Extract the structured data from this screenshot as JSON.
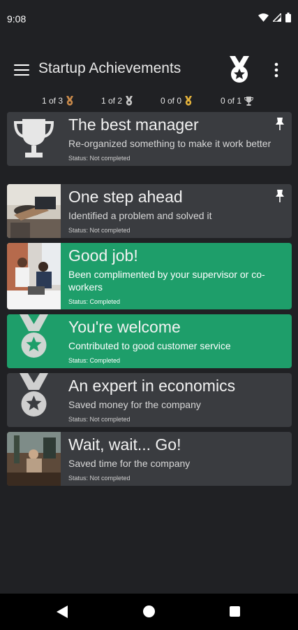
{
  "status_bar": {
    "time": "9:08"
  },
  "app_bar": {
    "title": "Startup Achievements"
  },
  "summary": [
    {
      "text": "1 of 3",
      "icon": "bronze-medal-icon",
      "color": "#c98a4a"
    },
    {
      "text": "1 of 2",
      "icon": "silver-medal-icon",
      "color": "#c8c8c8"
    },
    {
      "text": "0 of 0",
      "icon": "gold-medal-icon",
      "color": "#e3b23c"
    },
    {
      "text": "0 of 1",
      "icon": "trophy-icon",
      "color": "#c8c8c8"
    }
  ],
  "achievements": [
    {
      "title": "The best manager",
      "description": "Re-organized something to make it work better",
      "status": "Status: Not completed",
      "completed": false,
      "pinned": true,
      "icon": "trophy-icon"
    },
    {
      "title": "One step ahead",
      "description": "Identified a problem and solved it",
      "status": "Status: Not completed",
      "completed": false,
      "pinned": true,
      "icon": "office-photo"
    },
    {
      "title": "Good job!",
      "description": "Been complimented by your supervisor or co-workers",
      "status": "Status: Completed",
      "completed": true,
      "pinned": false,
      "icon": "team-photo"
    },
    {
      "title": "You're welcome",
      "description": "Contributed to good customer service",
      "status": "Status: Completed",
      "completed": true,
      "pinned": false,
      "icon": "medal-icon"
    },
    {
      "title": "An expert in economics",
      "description": "Saved money for the company",
      "status": "Status: Not completed",
      "completed": false,
      "pinned": false,
      "icon": "medal-icon"
    },
    {
      "title": "Wait, wait... Go!",
      "description": "Saved time for the company",
      "status": "Status: Not completed",
      "completed": false,
      "pinned": false,
      "icon": "cafe-photo"
    }
  ],
  "colors": {
    "completed": "#1e9e6a",
    "card": "#3a3c40",
    "background": "#202124"
  }
}
